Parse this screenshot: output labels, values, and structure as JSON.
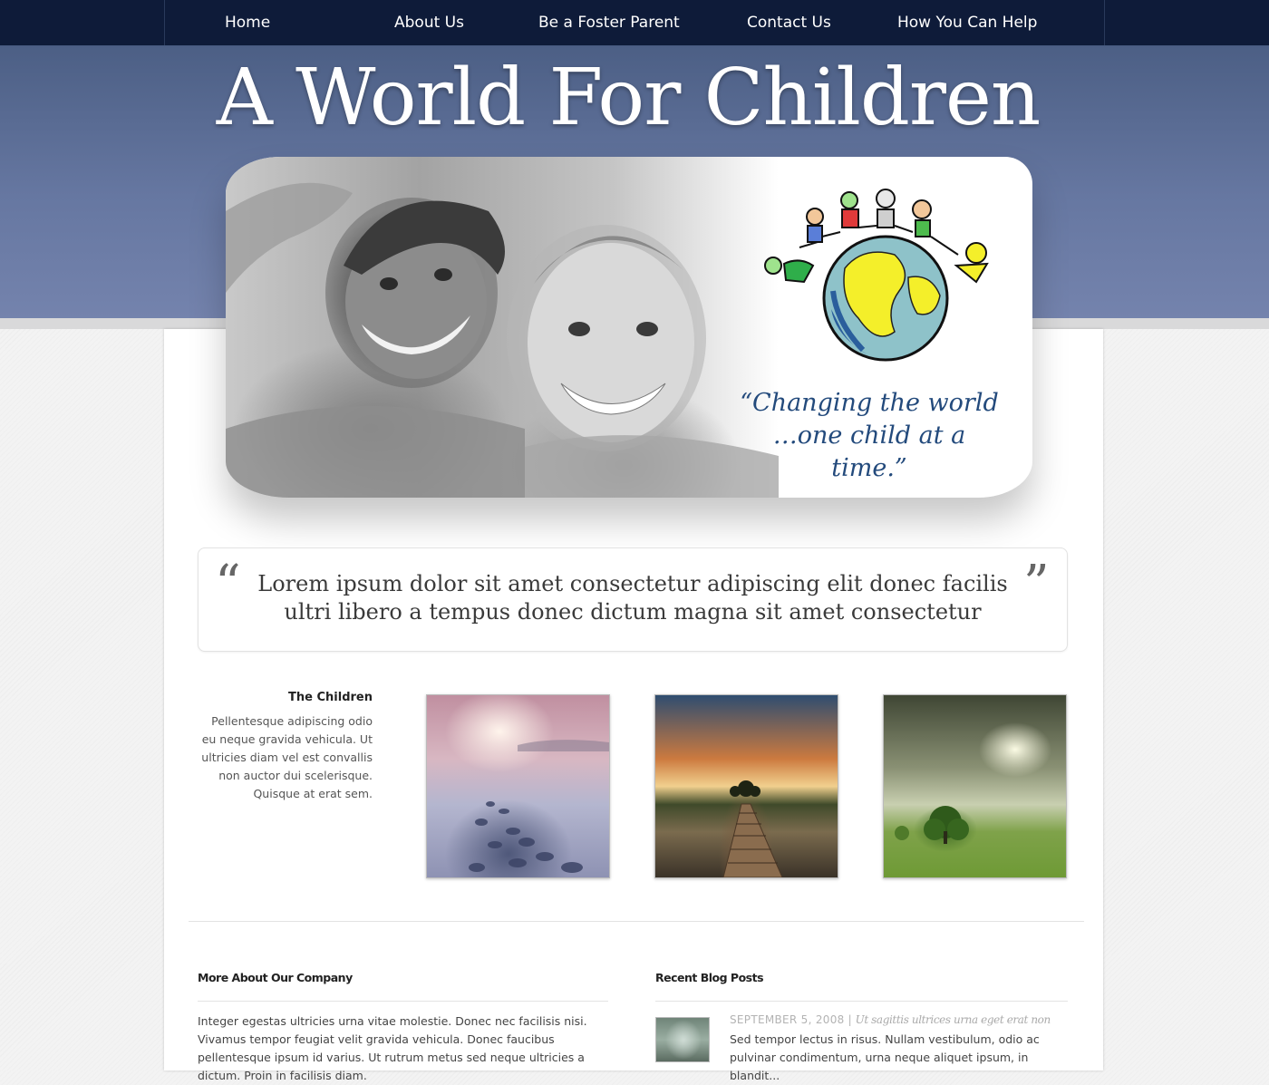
{
  "nav": {
    "items": [
      {
        "label": "Home"
      },
      {
        "label": "About Us"
      },
      {
        "label": "Be a Foster Parent"
      },
      {
        "label": "Contact Us"
      },
      {
        "label": "How You Can Help"
      }
    ]
  },
  "header": {
    "title": "A World For Children"
  },
  "hero": {
    "tagline_line1": "“Changing the world",
    "tagline_line2": "…one child at a time.”",
    "photo_icon": "children-photo",
    "logo_icon": "globe-kids-logo-icon"
  },
  "quote": {
    "open_mark": "“",
    "close_mark": "”",
    "text": "Lorem ipsum dolor sit amet consectetur adipiscing elit donec facilis ultri libero a tempus donec dictum magna sit amet consectetur"
  },
  "children": {
    "title": "The Children",
    "text": "Pellentesque adipiscing odio eu neque gravida vehicula. Ut ultricies diam vel est convallis non auctor dui scelerisque. Quisque at erat sem."
  },
  "gallery": {
    "items": [
      {
        "icon": "misty-lake-photo"
      },
      {
        "icon": "pier-sunset-photo"
      },
      {
        "icon": "tree-field-photo"
      }
    ]
  },
  "company": {
    "heading": "More About Our Company",
    "text": "Integer egestas ultricies urna vitae molestie. Donec nec facilisis nisi. Vivamus tempor feugiat velit gravida vehicula. Donec faucibus pellentesque ipsum id varius. Ut rutrum metus sed neque ultricies a dictum. Proin in facilisis diam."
  },
  "blog": {
    "heading": "Recent Blog Posts",
    "posts": [
      {
        "date": "SEPTEMBER 5, 2008",
        "separator": "|",
        "title": "Ut sagittis ultrices urna eget erat non",
        "excerpt": "Sed tempor lectus in risus. Nullam vestibulum, odio ac pulvinar condimentum, urna neque aliquet ipsum, in blandit..."
      }
    ]
  },
  "colors": {
    "nav_bg": "#0e1b39",
    "hero_top": "#4c5f85",
    "hero_bottom": "#7483ad",
    "tagline": "#234a7c"
  }
}
